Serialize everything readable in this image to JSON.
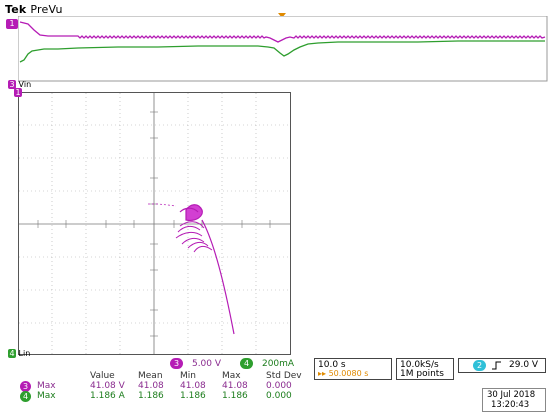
{
  "header": {
    "brand": "Tek",
    "mode": "PreVu"
  },
  "top_trace": {
    "marker_label": "1"
  },
  "xy": {
    "vin_label": "Vin",
    "vin_marker": "3",
    "zero_marker": "1",
    "lin_label": "Lin",
    "lin_marker": "4"
  },
  "scale": {
    "ch3": {
      "badge": "3",
      "value": "5.00 V"
    },
    "ch4": {
      "badge": "4",
      "value": "200mA"
    }
  },
  "timebase": {
    "time_div": "10.0 s",
    "position": "▸▸ 50.0080 s"
  },
  "acq": {
    "sample_rate": "10.0kS/s",
    "record": "1M points"
  },
  "trigger": {
    "badge": "2",
    "slope_icon": "rising-edge-icon",
    "level": "29.0 V"
  },
  "datetime": {
    "date": "30 Jul  2018",
    "time": "13:20:43"
  },
  "measurements": {
    "headers": [
      "Value",
      "Mean",
      "Min",
      "Max",
      "Std Dev"
    ],
    "rows": [
      {
        "badge": "3",
        "name": "Max",
        "value": "41.08 V",
        "mean": "41.08",
        "min": "41.08",
        "max": "41.08",
        "std": "0.000"
      },
      {
        "badge": "4",
        "name": "Max",
        "value": "1.186 A",
        "mean": "1.186",
        "min": "1.186",
        "max": "1.186",
        "std": "0.000"
      }
    ]
  },
  "colors": {
    "ch3": "#b51cb5",
    "ch4": "#2e9e2e",
    "ch2": "#2fc0d8",
    "trigger": "#e08a00"
  }
}
